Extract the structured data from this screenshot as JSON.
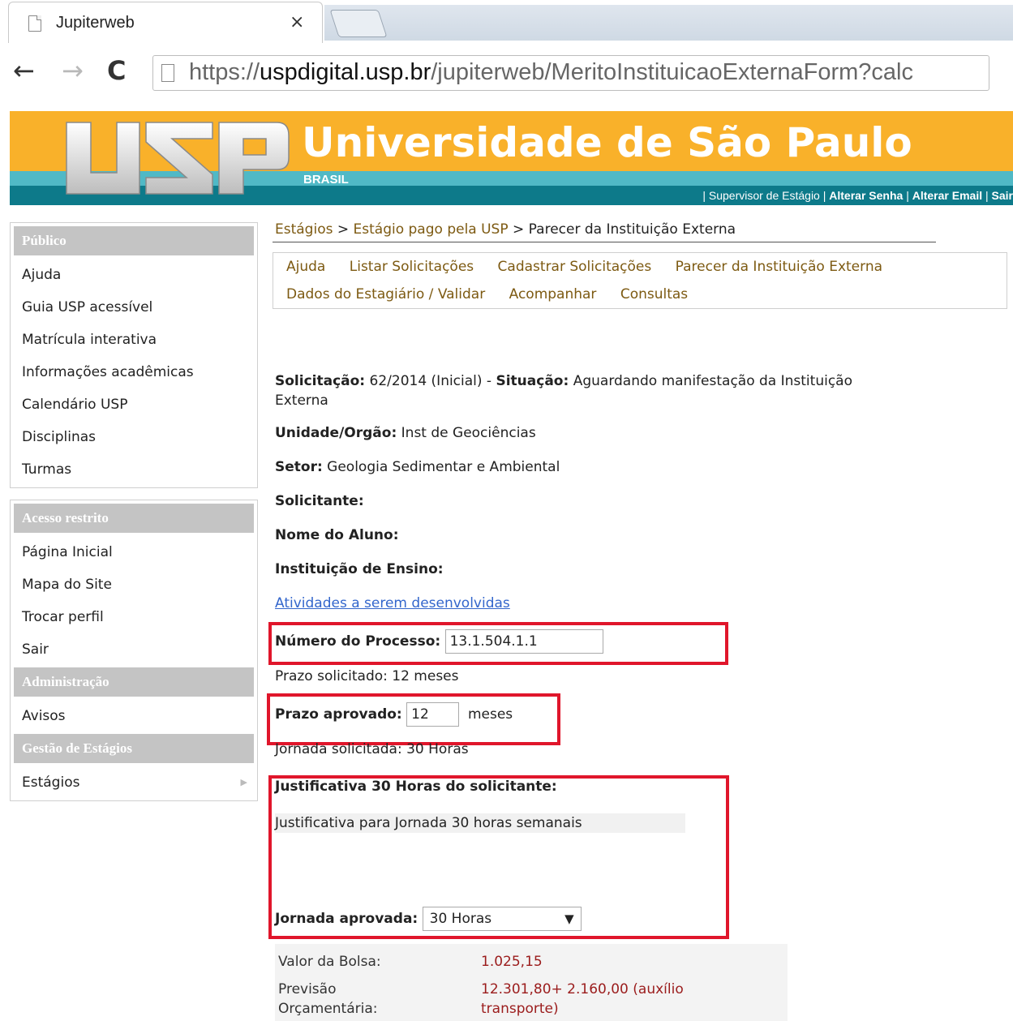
{
  "browser": {
    "tab_title": "Jupiterweb",
    "close_glyph": "×",
    "back_glyph": "←",
    "forward_glyph": "→",
    "reload_glyph": "C",
    "url_prefix": "https://",
    "url_domain": "uspdigital.usp.br",
    "url_path": "/jupiterweb/MeritoInstituicaoExternaForm?calc",
    "menu_glyph": "⋮"
  },
  "header": {
    "title": "Universidade de São Paulo",
    "subtitle": "BRASIL",
    "links": [
      "Supervisor de Estágio",
      "Alterar Senha",
      "Alterar Email",
      "Sair"
    ],
    "colors": {
      "orange": "#f9b12a",
      "teal": "#50b9c6",
      "dark_teal": "#0d7a8a"
    }
  },
  "sidebar": {
    "sections": [
      {
        "heading": "Público",
        "items": [
          "Ajuda",
          "Guia USP acessível",
          "Matrícula interativa",
          "Informações acadêmicas",
          "Calendário USP",
          "Disciplinas",
          "Turmas"
        ]
      },
      {
        "heading": "Acesso restrito",
        "items": [
          "Página Inicial",
          "Mapa do Site",
          "Trocar perfil",
          "Sair"
        ]
      },
      {
        "heading": "Administração",
        "items": [
          "Avisos"
        ]
      },
      {
        "heading": "Gestão de Estágios",
        "items": [
          "Estágios"
        ]
      }
    ]
  },
  "breadcrumb": {
    "items": [
      "Estágios",
      "Estágio pago pela USP"
    ],
    "current": "Parecer da Instituição Externa",
    "separator": ">"
  },
  "subnav": {
    "row1": [
      "Ajuda",
      "Listar Solicitações",
      "Cadastrar Solicitações",
      "Parecer da Instituição Externa"
    ],
    "row2": [
      "Dados do Estagiário / Validar",
      "Acompanhar",
      "Consultas"
    ]
  },
  "form": {
    "solicitacao_label": "Solicitação:",
    "solicitacao_value": "62/2014 (Inicial)",
    "situacao_label": "Situação:",
    "situacao_value": "Aguardando manifestação da Instituição",
    "situacao_value2": "Externa",
    "unidade_label": "Unidade/Orgão:",
    "unidade_value": "Inst de Geociências",
    "setor_label": "Setor:",
    "setor_value": "Geologia Sedimentar e Ambiental",
    "solicitante_label": "Solicitante:",
    "nome_aluno_label": "Nome do Aluno:",
    "instituicao_label": "Instituição de Ensino:",
    "atividades_link": "Atividades a serem desenvolvidas",
    "processo_label": "Número do Processo:",
    "processo_value": "13.1.504.1.1",
    "prazo_solicitado": "Prazo solicitado: 12 meses",
    "prazo_aprovado_label": "Prazo aprovado:",
    "prazo_aprovado_value": "12",
    "prazo_unit": "meses",
    "jornada_solicitada": "Jornada solicitada: 30 Horas",
    "justificativa_label": "Justificativa 30 Horas do solicitante:",
    "justificativa_text": "Justificativa para Jornada 30 horas semanais",
    "jornada_aprovada_label": "Jornada aprovada:",
    "jornada_aprovada_value": "30 Horas",
    "bolsa_label": "Valor da Bolsa:",
    "bolsa_value": "1.025,15",
    "previsao_label1": "Previsão",
    "previsao_label2": "Orçamentária:",
    "previsao_value1": "12.301,80+ 2.160,00 (auxílio",
    "previsao_value2": "transporte)"
  },
  "highlight_color": "#e0162b"
}
